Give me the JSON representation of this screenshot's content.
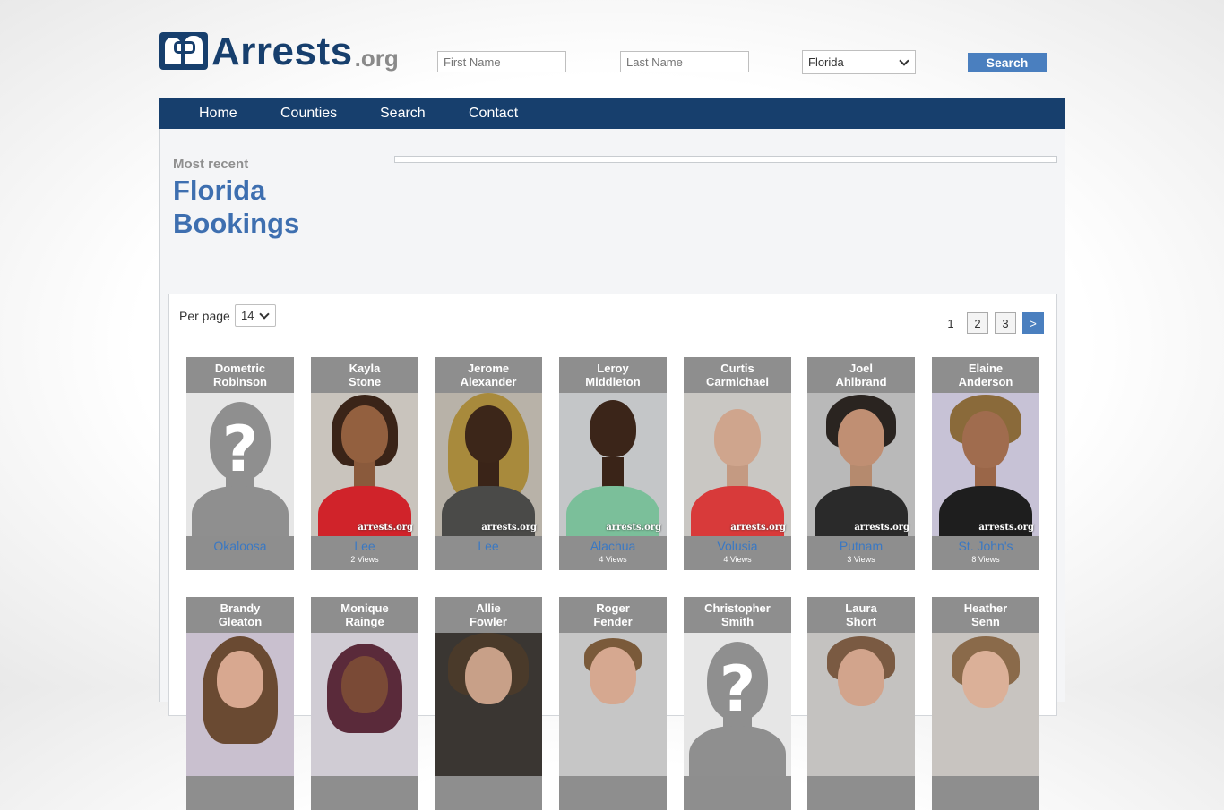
{
  "header": {
    "logo_main": "Arrests",
    "logo_suffix": ".org",
    "first_name_placeholder": "First Name",
    "last_name_placeholder": "Last Name",
    "state_selected": "Florida",
    "search_label": "Search"
  },
  "nav": {
    "items": [
      "Home",
      "Counties",
      "Search",
      "Contact"
    ]
  },
  "intro": {
    "kicker": "Most recent",
    "title_line1": "Florida",
    "title_line2": "Bookings"
  },
  "listing": {
    "per_page_label": "Per page",
    "per_page_value": "14",
    "pagination": [
      "1",
      "2",
      "3",
      ">"
    ]
  },
  "watermark": "arrests.org",
  "placeholder_glyph": "?",
  "row1": [
    {
      "first": "Dometric",
      "last": "Robinson",
      "county": "Okaloosa",
      "views": "",
      "photo": "placeholder"
    },
    {
      "first": "Kayla",
      "last": "Stone",
      "county": "Lee",
      "views": "2 Views",
      "photo": "p1"
    },
    {
      "first": "Jerome",
      "last": "Alexander",
      "county": "Lee",
      "views": "",
      "photo": "p2"
    },
    {
      "first": "Leroy",
      "last": "Middleton",
      "county": "Alachua",
      "views": "4 Views",
      "photo": "p3"
    },
    {
      "first": "Curtis",
      "last": "Carmichael",
      "county": "Volusia",
      "views": "4 Views",
      "photo": "p4"
    },
    {
      "first": "Joel",
      "last": "Ahlbrand",
      "county": "Putnam",
      "views": "3 Views",
      "photo": "p5"
    },
    {
      "first": "Elaine",
      "last": "Anderson",
      "county": "St. John's",
      "views": "8 Views",
      "photo": "p6"
    }
  ],
  "row2": [
    {
      "first": "Brandy",
      "last": "Gleaton",
      "photo": "p7"
    },
    {
      "first": "Monique",
      "last": "Rainge",
      "photo": "p8"
    },
    {
      "first": "Allie",
      "last": "Fowler",
      "photo": "p9"
    },
    {
      "first": "Roger",
      "last": "Fender",
      "photo": "p10"
    },
    {
      "first": "Christopher",
      "last": "Smith",
      "photo": "placeholder"
    },
    {
      "first": "Laura",
      "last": "Short",
      "photo": "p11"
    },
    {
      "first": "Heather",
      "last": "Senn",
      "photo": "p12"
    }
  ],
  "colors": {
    "navy": "#173f6d",
    "link_blue": "#3a78c3",
    "button_blue": "#4a7fbf",
    "card_gray": "#8e8e8e"
  },
  "icons": {
    "logo": "handcuffed-figures-icon",
    "select": "chevron-down-icon"
  }
}
